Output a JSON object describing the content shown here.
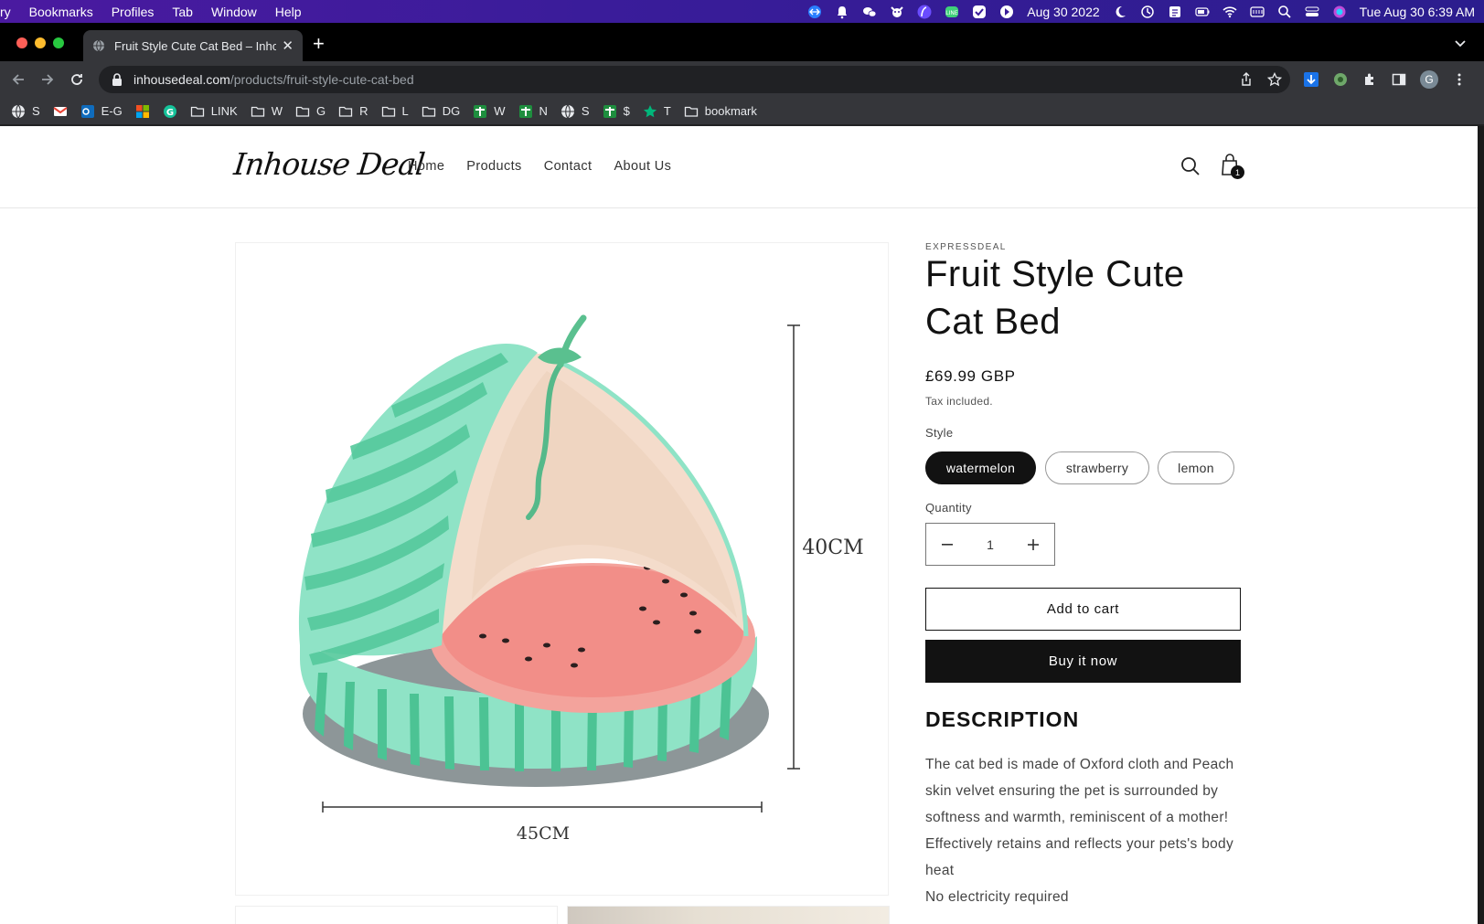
{
  "menubar": {
    "items": [
      "ry",
      "Bookmarks",
      "Profiles",
      "Tab",
      "Window",
      "Help"
    ],
    "date_text": "Aug 30 2022",
    "clock": "Tue Aug 30  6:39 AM",
    "status_icons": [
      "teamviewer-icon",
      "notification-bell-icon",
      "wechat-icon",
      "cow-app-icon",
      "feather-icon",
      "line-icon",
      "checkbox-icon",
      "arrow-circle-icon",
      "moon-icon",
      "history-icon",
      "calendar-icon",
      "battery-icon",
      "wifi-icon",
      "keyboard-icon",
      "spotlight-search-icon",
      "control-center-icon",
      "siri-icon"
    ]
  },
  "browser": {
    "tab_title": "Fruit Style Cute Cat Bed – Inho",
    "url_host": "inhousedeal.com",
    "url_path": "/products/fruit-style-cute-cat-bed",
    "profile_initial": "G",
    "bookmarks": [
      {
        "label": "S",
        "icon": "globe-icon"
      },
      {
        "label": "",
        "icon": "gmail-icon"
      },
      {
        "label": "E-G",
        "icon": "outlook-icon"
      },
      {
        "label": "",
        "icon": "microsoft-icon"
      },
      {
        "label": "",
        "icon": "grammarly-icon"
      },
      {
        "label": "LINK",
        "icon": "folder-icon"
      },
      {
        "label": "W",
        "icon": "folder-icon"
      },
      {
        "label": "G",
        "icon": "folder-icon"
      },
      {
        "label": "R",
        "icon": "folder-icon"
      },
      {
        "label": "L",
        "icon": "folder-icon"
      },
      {
        "label": "DG",
        "icon": "folder-icon"
      },
      {
        "label": "W",
        "icon": "green-plus-icon"
      },
      {
        "label": "N",
        "icon": "green-plus-icon"
      },
      {
        "label": "S",
        "icon": "globe-icon"
      },
      {
        "label": "$",
        "icon": "green-plus-icon"
      },
      {
        "label": "T",
        "icon": "star-icon"
      },
      {
        "label": "bookmark",
        "icon": "folder-icon"
      }
    ]
  },
  "store": {
    "logo": "Inhouse Deal",
    "nav": [
      "Home",
      "Products",
      "Contact",
      "About Us"
    ],
    "cart_count": "1"
  },
  "product": {
    "vendor": "EXPRESSDEAL",
    "title": "Fruit Style Cute Cat Bed",
    "price": "£69.99 GBP",
    "tax_note": "Tax included.",
    "style_label": "Style",
    "styles": [
      "watermelon",
      "strawberry",
      "lemon"
    ],
    "selected_style": "watermelon",
    "quantity_label": "Quantity",
    "quantity": "1",
    "add_to_cart": "Add to cart",
    "buy_now": "Buy it now",
    "description_heading": "DESCRIPTION",
    "description_lines": [
      "The cat bed is made of Oxford cloth and Peach skin velvet ensuring the pet is surrounded by softness and warmth, reminiscent of a mother!",
      "Effectively retains and reflects your pets's body heat",
      "No electricity required"
    ],
    "image_dims": {
      "height": "40CM",
      "width": "45CM"
    }
  },
  "colors": {
    "menubar_bg": "#3a1c9a",
    "button_dark": "#121212",
    "melon_green": "#7fd8b8",
    "melon_stripe": "#4cc394",
    "melon_flesh": "#f08a86"
  }
}
